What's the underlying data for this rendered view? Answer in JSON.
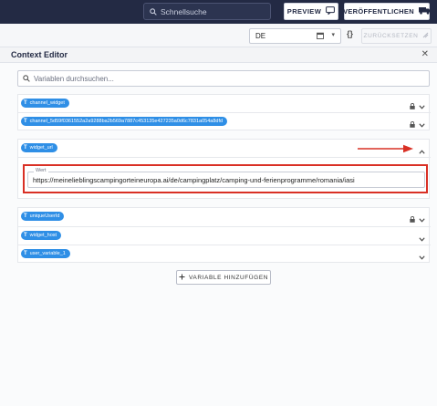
{
  "topbar": {
    "search_placeholder": "Schnellsuche",
    "preview_label": "PREVIEW",
    "publish_label": "VERÖFFENTLICHEN"
  },
  "toolbar": {
    "language_value": "DE",
    "code_label": "{}",
    "reset_label": "ZURÜCKSETZEN"
  },
  "panel": {
    "title": "Context Editor",
    "filter_placeholder": "Variablen durchsuchen..."
  },
  "variables_top": [
    {
      "name": "channel_widget",
      "locked": true
    },
    {
      "name": "channel_5d59f0361552a2a9288ba2b569a7887c453135e427235a0d6c7831a054a8dfd",
      "locked": true
    }
  ],
  "expanded_variable": {
    "name": "widget_url",
    "value_label": "Wert",
    "value": "https://meinelieblingscampingorteineuropa.ai/de/campingplatz/camping-und-ferienprogramme/romania/iasi"
  },
  "variables_bottom": [
    {
      "name": "uniqueUserId",
      "locked": true
    },
    {
      "name": "widget_host",
      "locked": false
    },
    {
      "name": "user_variable_1",
      "locked": false
    }
  ],
  "add_variable_label": "VARIABLE HINZUFÜGEN",
  "colors": {
    "topbar": "#232a44",
    "chip": "#2f8fe6",
    "highlight": "#d93025"
  }
}
